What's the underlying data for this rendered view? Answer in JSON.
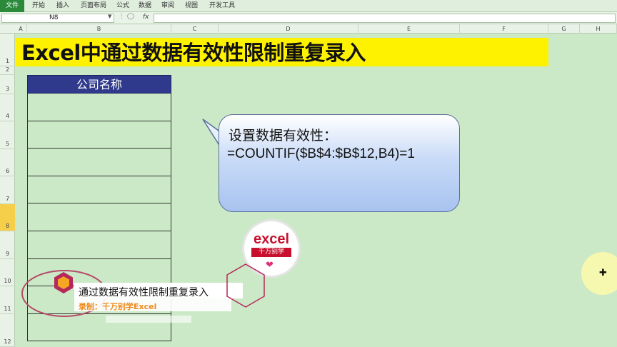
{
  "ribbon": {
    "tabs": [
      "文件",
      "开始",
      "插入",
      "页面布局",
      "公式",
      "数据",
      "审阅",
      "视图",
      "开发工具"
    ]
  },
  "formula_bar": {
    "name_box": "N8",
    "fx_label": "fx",
    "formula": ""
  },
  "columns": [
    "A",
    "B",
    "C",
    "D",
    "E",
    "F",
    "G",
    "H"
  ],
  "rows": [
    "1",
    "2",
    "3",
    "4",
    "5",
    "6",
    "7",
    "8",
    "9",
    "10",
    "11",
    "12"
  ],
  "selected_row": "8",
  "sheet": {
    "title": "Excel中通过数据有效性限制重复录入",
    "table_header": "公司名称"
  },
  "callout": {
    "line1": "设置数据有效性：",
    "line2": "=COUNTIF($B$4:$B$12,B4)=1"
  },
  "logo": {
    "main": "excel",
    "sub": "千万别学"
  },
  "overlay": {
    "title": "通过数据有效性限制重复录入",
    "credit": "录制：千万别学Excel"
  },
  "colors": {
    "sheet_bg": "#cbe9c6",
    "title_band": "#fff200",
    "table_header": "#2f3a8c",
    "credit": "#f08a1c",
    "logo_red": "#c8102e",
    "selected_row": "#f6cf4a"
  }
}
